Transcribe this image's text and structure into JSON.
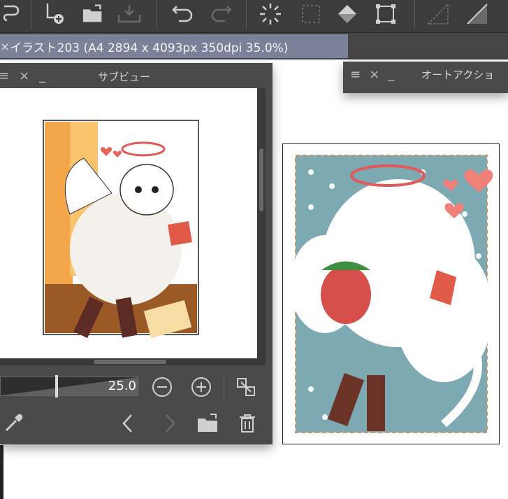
{
  "toolbar": {
    "icons": [
      "lasso-icon",
      "new-layer-icon",
      "open-folder-icon",
      "save-icon",
      "undo-icon",
      "redo-icon",
      "loading-icon",
      "select-icon",
      "fill-icon",
      "transform-icon",
      "ruler-icon",
      "perspective-icon"
    ]
  },
  "document_tab": {
    "close": "×",
    "title": "イラスト203 (A4 2894 x 4093px 350dpi 35.0%)"
  },
  "sub_view": {
    "title": "サブビュー",
    "menu_glyph": "≡",
    "close_glyph": "×",
    "minimize_glyph": "_",
    "zoom_value": "25.0"
  },
  "auto_action": {
    "title": "オートアクショ",
    "menu_glyph": "≡",
    "close_glyph": "×",
    "minimize_glyph": "_"
  },
  "colors": {
    "toolbar_bg": "#3c3c3c",
    "tab_active": "#7a8199",
    "panel_bg": "#4a4a4a",
    "stamp_bg": "#7da9b3",
    "halo": "#e05a5a"
  }
}
